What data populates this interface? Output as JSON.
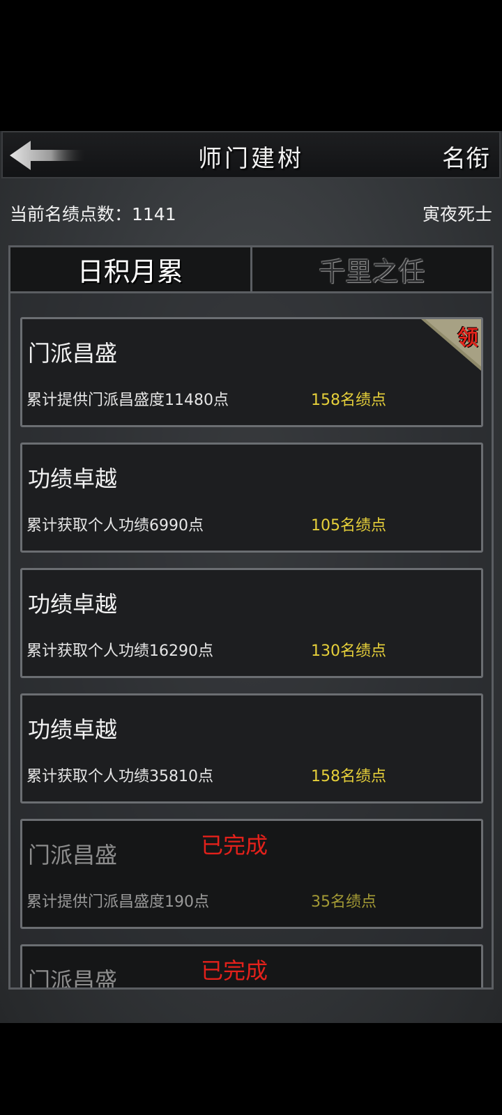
{
  "header": {
    "title": "师门建树",
    "right_label": "名衔"
  },
  "info": {
    "points_label": "当前名绩点数：1141",
    "player_name": "寅夜死士"
  },
  "tabs": [
    {
      "label": "日积月累",
      "active": true
    },
    {
      "label": "千里之任",
      "active": false
    }
  ],
  "tasks": [
    {
      "name": "门派昌盛",
      "desc": "累计提供门派昌盛度11480点",
      "reward": "158名绩点",
      "status": "claimable",
      "badge": "领"
    },
    {
      "name": "功绩卓越",
      "desc": "累计获取个人功绩6990点",
      "reward": "105名绩点",
      "status": "in-progress"
    },
    {
      "name": "功绩卓越",
      "desc": "累计获取个人功绩16290点",
      "reward": "130名绩点",
      "status": "in-progress"
    },
    {
      "name": "功绩卓越",
      "desc": "累计获取个人功绩35810点",
      "reward": "158名绩点",
      "status": "in-progress"
    },
    {
      "name": "门派昌盛",
      "desc": "累计提供门派昌盛度190点",
      "reward": "35名绩点",
      "status": "done",
      "done_label": "已完成"
    },
    {
      "name": "门派昌盛",
      "status": "done",
      "done_label": "已完成"
    }
  ],
  "colors": {
    "reward": "#e6d03a",
    "done": "#e3211b",
    "badge": "#e0241c"
  },
  "icons": {
    "back": "back-arrow-icon"
  }
}
